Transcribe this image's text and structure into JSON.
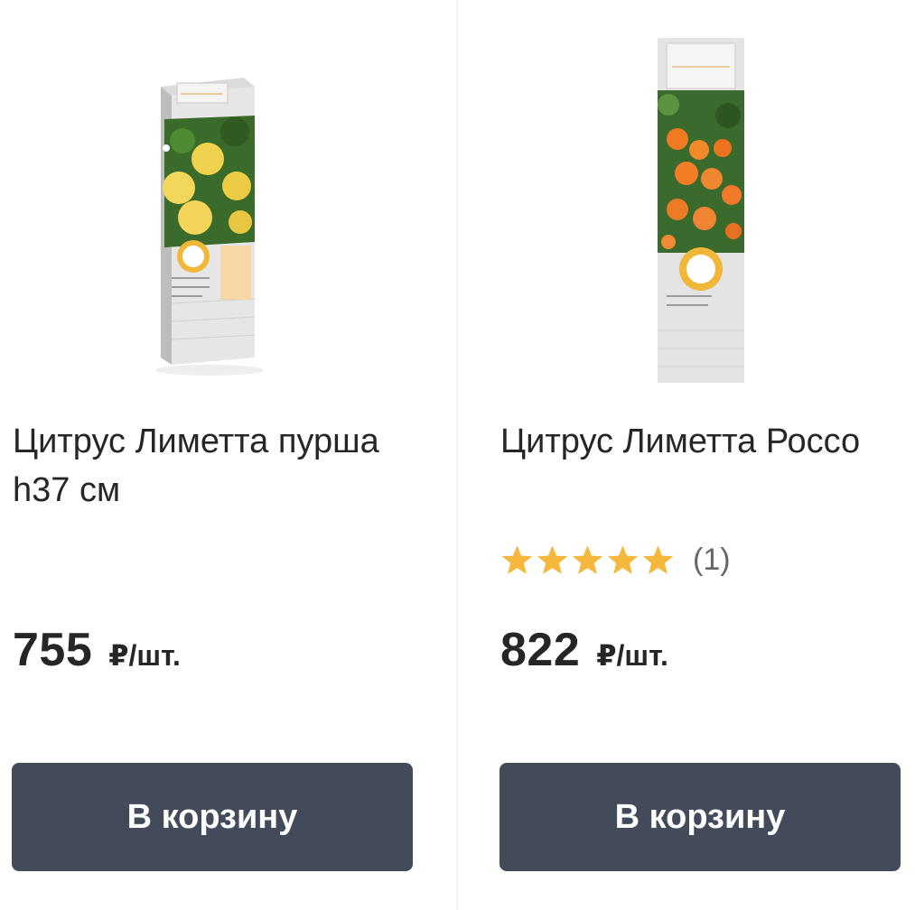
{
  "products": [
    {
      "title": "Цитрус Лиметта пурша h37 см",
      "price": "755",
      "price_unit": "₽/шт.",
      "button_label": "В корзину",
      "image_kind": "yellow-lime-package"
    },
    {
      "title": "Цитрус Лиметта Россо",
      "rating": 5,
      "rating_count": "(1)",
      "price": "822",
      "price_unit": "₽/шт.",
      "button_label": "В корзину",
      "image_kind": "orange-lime-package"
    }
  ],
  "colors": {
    "button_bg": "#434a5a",
    "star": "#f5b83d",
    "text": "#262626"
  }
}
